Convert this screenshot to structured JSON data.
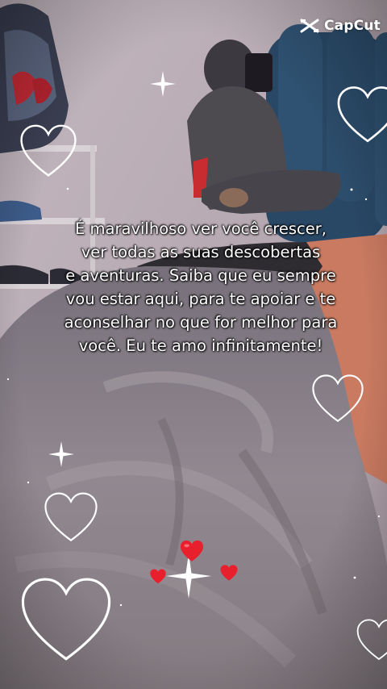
{
  "watermark": {
    "brand": "CapCut",
    "icon": "capcut-logo-icon"
  },
  "caption": {
    "lines": [
      "É maravilhoso ver você crescer,",
      "ver todas as suas descobertas",
      "e aventuras. Saiba que eu sempre",
      "vou estar aqui, para te apoiar e te",
      "aconselhar no que for melhor para",
      "você. Eu te amo infinitamente!"
    ],
    "color": "#ffffff"
  },
  "decorations": {
    "outline_heart_icon": "heart-outline-icon",
    "sparkle_icon": "sparkle-icon",
    "red_heart_icon": "red-heart-icon",
    "red_heart_color": "#e8202e"
  },
  "palette": {
    "wall": "#b7a9b1",
    "blanket": "#8d8489",
    "floor": "#c27a63",
    "headboard": "#2a4a66"
  }
}
